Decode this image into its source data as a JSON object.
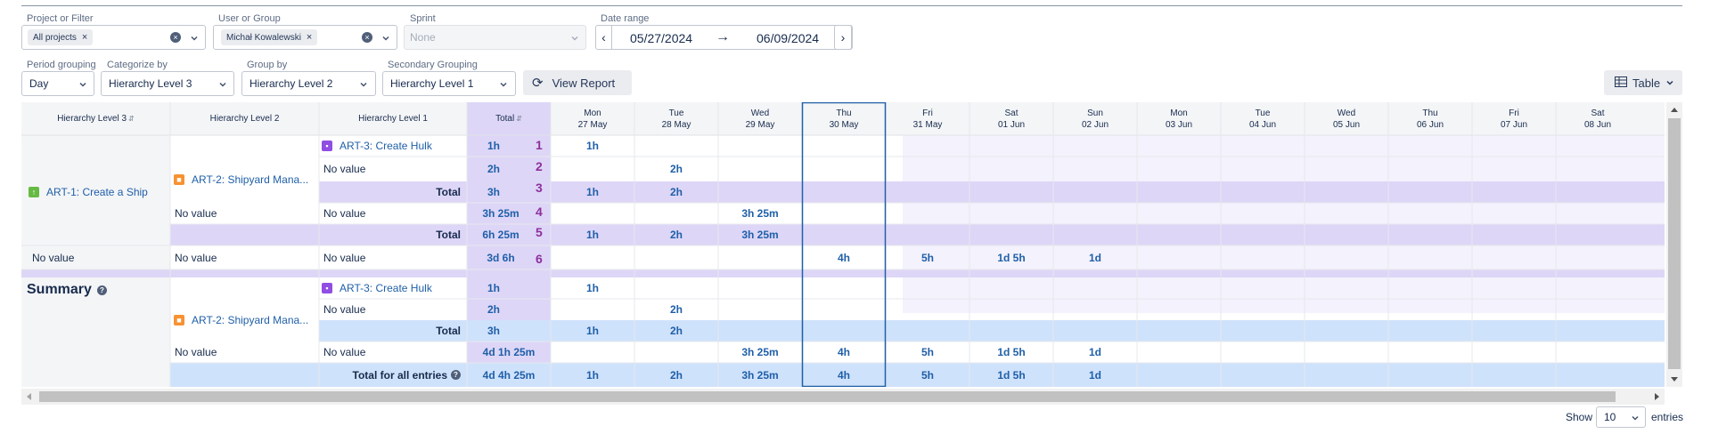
{
  "filters": {
    "project": {
      "label": "Project or Filter",
      "chip": "All projects"
    },
    "user": {
      "label": "User or Group",
      "chip": "Michał Kowalewski"
    },
    "sprint": {
      "label": "Sprint",
      "placeholder": "None"
    },
    "date": {
      "label": "Date range",
      "start": "05/27/2024",
      "end": "06/09/2024"
    },
    "period": {
      "label": "Period grouping",
      "value": "Day"
    },
    "categorize": {
      "label": "Categorize by",
      "value": "Hierarchy Level 3"
    },
    "group": {
      "label": "Group by",
      "value": "Hierarchy Level 2"
    },
    "secondary": {
      "label": "Secondary Grouping",
      "value": "Hierarchy Level 1"
    },
    "view_report": "View Report",
    "view_mode": "Table"
  },
  "columns": {
    "h3": "Hierarchy Level 3",
    "h2": "Hierarchy Level 2",
    "h1": "Hierarchy Level 1",
    "total": "Total",
    "days": [
      {
        "dow": "Mon",
        "date": "27 May"
      },
      {
        "dow": "Tue",
        "date": "28 May"
      },
      {
        "dow": "Wed",
        "date": "29 May"
      },
      {
        "dow": "Thu",
        "date": "30 May"
      },
      {
        "dow": "Fri",
        "date": "31 May"
      },
      {
        "dow": "Sat",
        "date": "01 Jun"
      },
      {
        "dow": "Sun",
        "date": "02 Jun"
      },
      {
        "dow": "Mon",
        "date": "03 Jun"
      },
      {
        "dow": "Tue",
        "date": "04 Jun"
      },
      {
        "dow": "Wed",
        "date": "05 Jun"
      },
      {
        "dow": "Thu",
        "date": "06 Jun"
      },
      {
        "dow": "Fri",
        "date": "07 Jun"
      },
      {
        "dow": "Sat",
        "date": "08 Jun"
      }
    ]
  },
  "rows": {
    "art1": "ART-1: Create a Ship",
    "art2": "ART-2: Shipyard Mana...",
    "art3": "ART-3: Create Hulk",
    "no_value": "No value",
    "total": "Total",
    "summary": "Summary",
    "total_all": "Total for all entries",
    "r1": {
      "total": "1h",
      "marker": "1",
      "d0": "1h"
    },
    "r2": {
      "total": "2h",
      "marker": "2",
      "d1": "2h"
    },
    "r3": {
      "total": "3h",
      "marker": "3",
      "d0": "1h",
      "d1": "2h"
    },
    "r4": {
      "total": "3h 25m",
      "marker": "4",
      "d2": "3h 25m"
    },
    "r5": {
      "total": "6h 25m",
      "marker": "5",
      "d0": "1h",
      "d1": "2h",
      "d2": "3h 25m"
    },
    "r6": {
      "total": "3d 6h",
      "marker": "6",
      "d3": "4h",
      "d4": "5h",
      "d5": "1d 5h",
      "d6": "1d"
    },
    "s1": {
      "total": "1h",
      "d0": "1h"
    },
    "s2": {
      "total": "2h",
      "d1": "2h"
    },
    "s3": {
      "total": "3h",
      "d0": "1h",
      "d1": "2h"
    },
    "s4": {
      "total": "4d 1h 25m",
      "d2": "3h 25m",
      "d3": "4h",
      "d4": "5h",
      "d5": "1d 5h",
      "d6": "1d"
    },
    "s5": {
      "total": "4d 4h 25m",
      "d0": "1h",
      "d1": "2h",
      "d2": "3h 25m",
      "d3": "4h",
      "d4": "5h",
      "d5": "1d 5h",
      "d6": "1d"
    }
  },
  "footer": {
    "show": "Show",
    "entries": "entries",
    "page_size": "10"
  },
  "colors": {
    "total_col": "#ddd6f7",
    "total_row": "#ddd6f7",
    "summary_row": "#cfe2fb",
    "accent": "#1f5fa8",
    "marker": "#8e2f9c"
  }
}
